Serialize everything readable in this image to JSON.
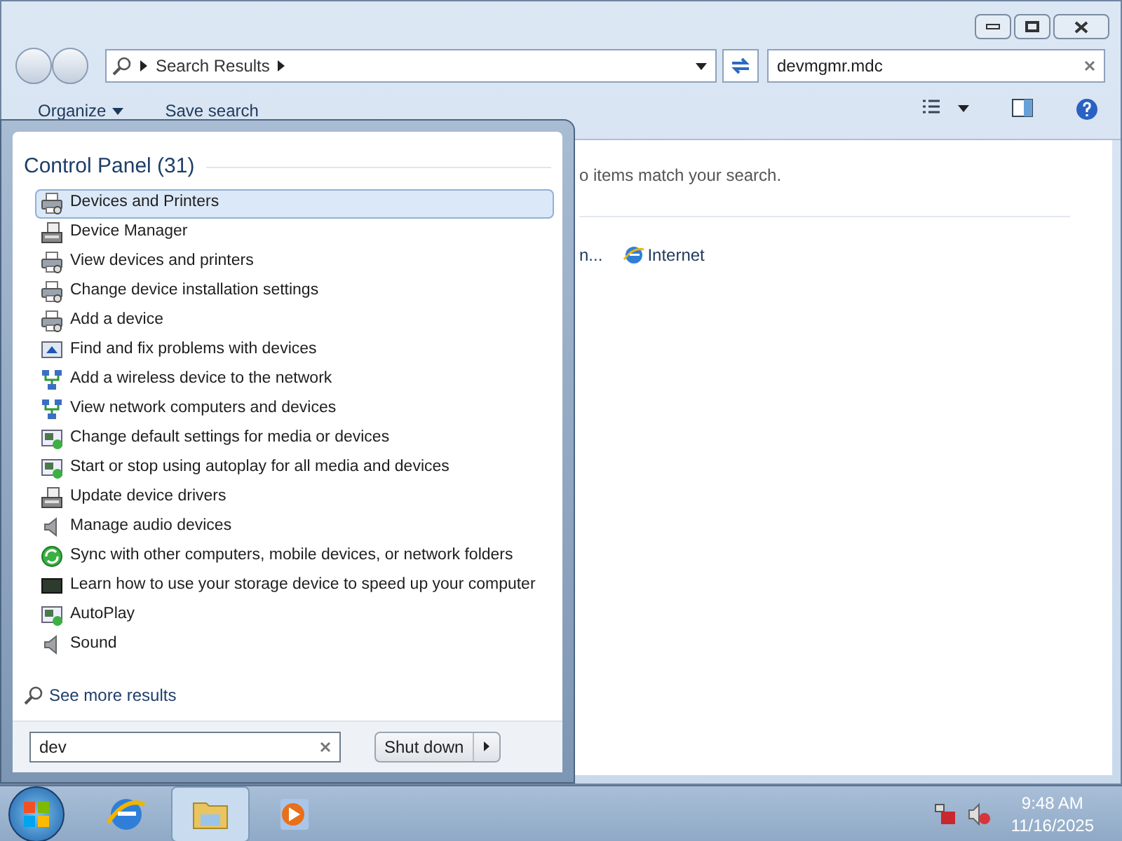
{
  "window": {
    "address": {
      "breadcrumb": "Search Results"
    },
    "search": {
      "value": "devmgmr.mdc"
    },
    "toolbar": [
      {
        "label": "Organize",
        "kind": "menu"
      },
      {
        "label": "Save search",
        "kind": "plain"
      }
    ],
    "content": {
      "message": "o items match your search.",
      "search_again": [
        {
          "label": "n...",
          "kind": "plain"
        },
        {
          "label": "Internet",
          "kind": "internet"
        }
      ]
    }
  },
  "start_menu": {
    "group_title": "Control Panel (31)",
    "results": [
      {
        "label": "Devices and Printers",
        "kind": "printer",
        "selected": true
      },
      {
        "label": "Device Manager",
        "kind": "device-manager",
        "selected": false
      },
      {
        "label": "View devices and printers",
        "kind": "printer",
        "selected": false
      },
      {
        "label": "Change device installation settings",
        "kind": "printer",
        "selected": false
      },
      {
        "label": "Add a device",
        "kind": "printer",
        "selected": false
      },
      {
        "label": "Find and fix problems with devices",
        "kind": "troubleshoot",
        "selected": false
      },
      {
        "label": "Add a wireless device to the network",
        "kind": "network",
        "selected": false
      },
      {
        "label": "View network computers and devices",
        "kind": "network",
        "selected": false
      },
      {
        "label": "Change default settings for media or devices",
        "kind": "media",
        "selected": false
      },
      {
        "label": "Start or stop using autoplay for all media and devices",
        "kind": "media",
        "selected": false
      },
      {
        "label": "Update device drivers",
        "kind": "device-manager",
        "selected": false
      },
      {
        "label": "Manage audio devices",
        "kind": "speaker",
        "selected": false
      },
      {
        "label": "Sync with other computers, mobile devices, or network folders",
        "kind": "sync",
        "selected": false
      },
      {
        "label": "Learn how to use your storage device to speed up your computer",
        "kind": "storage",
        "selected": false
      },
      {
        "label": "AutoPlay",
        "kind": "media",
        "selected": false
      },
      {
        "label": "Sound",
        "kind": "speaker",
        "selected": false
      }
    ],
    "see_more": "See more results",
    "search": {
      "value": "dev"
    },
    "shutdown": "Shut down"
  },
  "taskbar": {
    "apps": [
      {
        "kind": "browser",
        "selected": false
      },
      {
        "kind": "explorer",
        "selected": true
      },
      {
        "kind": "media",
        "selected": false
      }
    ],
    "clock": {
      "time": "9:48 AM",
      "date": "11/16/2025"
    }
  }
}
